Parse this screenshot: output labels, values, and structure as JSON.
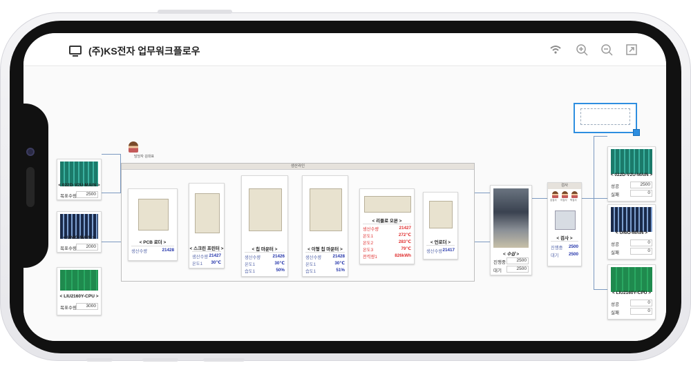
{
  "app": {
    "title": "(주)KS전자 업무워크플로우"
  },
  "header_icons": [
    "wifi-icon",
    "zoom-in-icon",
    "zoom-out-icon",
    "expand-icon"
  ],
  "colors": {
    "accent": "#2d8ee0",
    "value_blue": "#2233aa",
    "alert_red": "#e03030",
    "connector": "#7a98c0"
  },
  "group": {
    "title": "생산라인"
  },
  "avatar_caption": "담당자 김대표",
  "inputs": [
    {
      "name": "< 022D-V2U-MAIN >",
      "key": "목표수량",
      "value": "2500"
    },
    {
      "name": "< UNIO-MAIN >",
      "key": "목표수량",
      "value": "2000"
    },
    {
      "name": "< LIU2160Y-CPU >",
      "key": "목표수량",
      "value": "3000"
    }
  ],
  "machines": {
    "pcb_loader": {
      "label": "< PCB 로더 >",
      "rows": [
        {
          "k": "생산수량",
          "v": "21428"
        }
      ]
    },
    "screen_printer": {
      "label": "< 스크린 프린터 >",
      "rows": [
        {
          "k": "생산수량",
          "v": "21427"
        },
        {
          "k": "온도1",
          "v": "30℃"
        }
      ]
    },
    "chip_mounter": {
      "label": "< 칩 마운터 >",
      "rows": [
        {
          "k": "생산수량",
          "v": "21426"
        },
        {
          "k": "온도1",
          "v": "30℃"
        },
        {
          "k": "습도1",
          "v": "50%"
        }
      ]
    },
    "odd_mounter": {
      "label": "< 이형 칩 마운터 >",
      "rows": [
        {
          "k": "생산수량",
          "v": "21428"
        },
        {
          "k": "온도1",
          "v": "30℃"
        },
        {
          "k": "습도1",
          "v": "51%"
        }
      ]
    },
    "reflow_oven": {
      "label": "< 리플로 오븐 >",
      "rows": [
        {
          "k": "생산수량",
          "v": "21427"
        },
        {
          "k": "온도1",
          "v": "272℃"
        },
        {
          "k": "온도2",
          "v": "283℃"
        },
        {
          "k": "온도3",
          "v": "79℃"
        },
        {
          "k": "전력량1",
          "v": "826kWh"
        }
      ]
    },
    "unloader": {
      "label": "< 언로더 >",
      "rows": [
        {
          "k": "생산수량",
          "v": "21417"
        }
      ]
    }
  },
  "manual": {
    "label": "< 수삽 >",
    "rows": [
      {
        "k": "진행중",
        "v": "2500"
      },
      {
        "k": "대기",
        "v": "2500"
      }
    ]
  },
  "inspection": {
    "title": "검사",
    "people": [
      "김검사",
      "이검사",
      "박검사"
    ],
    "label": "< 검사 >",
    "rows": [
      {
        "k": "진행중",
        "v": "2500"
      },
      {
        "k": "대기",
        "v": "2500"
      }
    ]
  },
  "outputs": [
    {
      "name": "< 022D-V2U-MAIN >",
      "rows": [
        {
          "k": "성공",
          "v": "2500"
        },
        {
          "k": "실패",
          "v": "0"
        }
      ]
    },
    {
      "name": "< UNIO-MAIN >",
      "rows": [
        {
          "k": "성공",
          "v": "0"
        },
        {
          "k": "실패",
          "v": "0"
        }
      ]
    },
    {
      "name": "< LIU2160Y-CPU >",
      "rows": [
        {
          "k": "성공",
          "v": "0"
        },
        {
          "k": "실패",
          "v": "0"
        }
      ]
    }
  ]
}
